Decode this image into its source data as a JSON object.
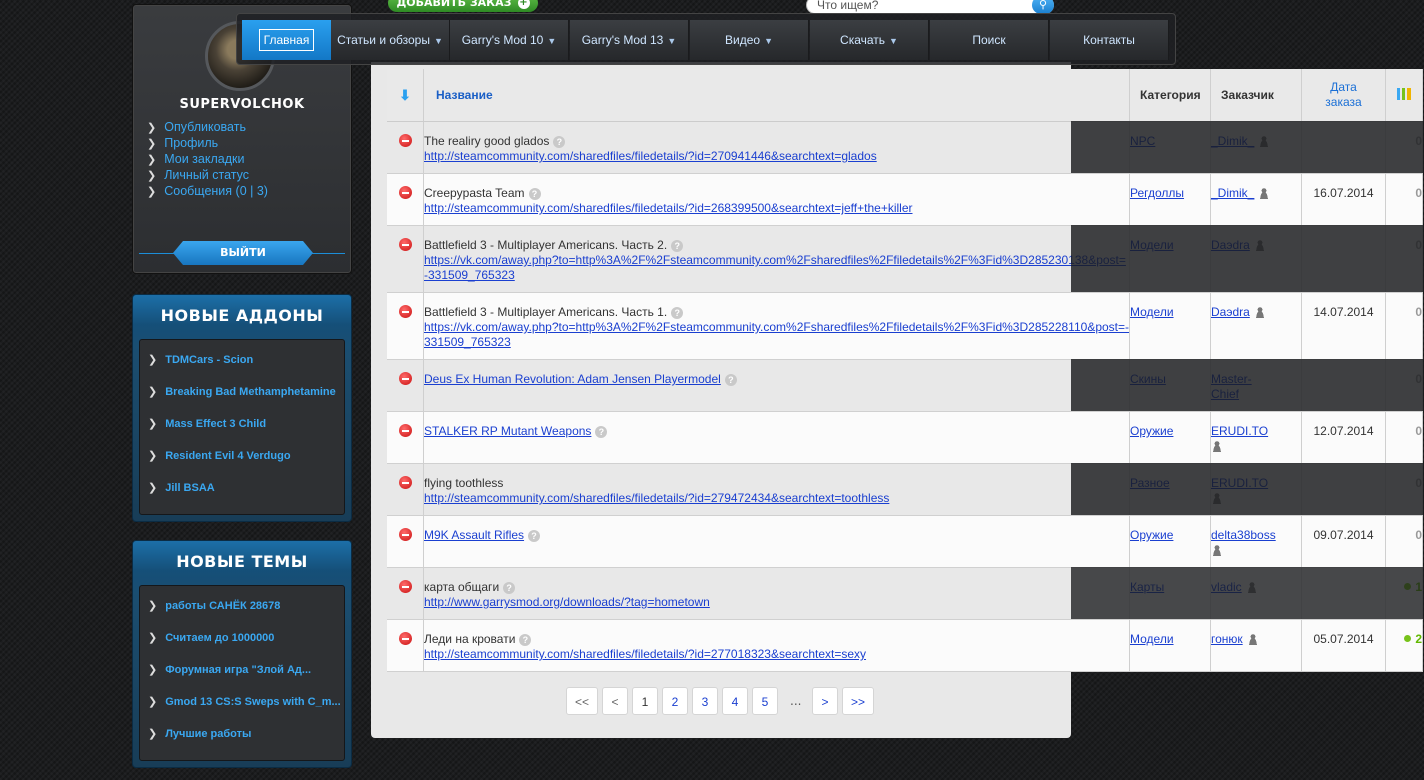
{
  "user": {
    "name": "SUPERVOLCHOK",
    "menu": [
      "Опубликовать",
      "Профиль",
      "Мои закладки",
      "Личный статус",
      "Сообщения (0 | 3)"
    ],
    "logout": "ВЫЙТИ"
  },
  "addons": {
    "title": "НОВЫЕ АДДОНЫ",
    "items": [
      "TDMCars - Scion",
      "Breaking Bad Methamphetamine",
      "Mass Effect 3 Child",
      "Resident Evil 4 Verdugo",
      "Jill BSAA"
    ]
  },
  "topics": {
    "title": "НОВЫЕ ТЕМЫ",
    "items": [
      "работы САНЁК 28678",
      "Считаем до 1000000",
      "Форумная игра \"Злой Ад...",
      "Gmod 13 CS:S Sweps with C_m...",
      "Лучшие работы"
    ]
  },
  "top": {
    "add_order": "ДОБАВИТЬ ЗАКАЗ",
    "search_placeholder": "Что ищем?"
  },
  "nav": [
    "Главная",
    "Статьи и обзоры",
    "Garry's Mod 10",
    "Garry's Mod 13",
    "Видео",
    "Скачать",
    "Поиск",
    "Контакты"
  ],
  "table": {
    "headers": {
      "name": "Название",
      "category": "Категория",
      "customer": "Заказчик",
      "date": "Дата заказа"
    },
    "rows": [
      {
        "title": "The realiry good glados",
        "link": "http://steamcommunity.com/sharedfiles/filedetails/?id=270941446&searchtext=glados",
        "category": "NPC",
        "customer": "_Dimik_",
        "date": "",
        "stat": "0"
      },
      {
        "title": "Creepypasta Team",
        "link": "http://steamcommunity.com/sharedfiles/filedetails/?id=268399500&searchtext=jeff+the+killer",
        "category": "Регдоллы",
        "customer": "_Dimik_",
        "date": "16.07.2014",
        "stat": "0"
      },
      {
        "title": "Battlefield 3 - Multiplayer Americans. Часть 2.",
        "link": "https://vk.com/away.php?to=http%3A%2F%2Fsteamcommunity.com%2Fsharedfiles%2Ffiledetails%2F%3Fid%3D285230138&post=-331509_765323",
        "category": "Модели",
        "customer": "Daэdra",
        "date": "",
        "stat": "0"
      },
      {
        "title": "Battlefield 3 - Multiplayer Americans. Часть 1.",
        "link": "https://vk.com/away.php?to=http%3A%2F%2Fsteamcommunity.com%2Fsharedfiles%2Ffiledetails%2F%3Fid%3D285228110&post=-331509_765323",
        "category": "Модели",
        "customer": "Daэdra",
        "date": "14.07.2014",
        "stat": "0"
      },
      {
        "title": "Deus Ex Human Revolution: Adam Jensen Playermodel",
        "link": "",
        "category": "Скины",
        "customer": "Master-Chief",
        "date": "",
        "stat": "0"
      },
      {
        "title": "STALKER RP Mutant Weapons",
        "link": "",
        "category": "Оружие",
        "customer": "ERUDI.TO",
        "date": "12.07.2014",
        "stat": "0"
      },
      {
        "title": "flying toothless",
        "link": "http://steamcommunity.com/sharedfiles/filedetails/?id=279472434&searchtext=toothless",
        "category": "Разное",
        "customer": "ERUDI.TO",
        "date": "",
        "stat": "0"
      },
      {
        "title": "M9K Assault Rifles",
        "link": "",
        "category": "Оружие",
        "customer": "delta38boss",
        "date": "09.07.2014",
        "stat": "0"
      },
      {
        "title": "карта общаги",
        "link": "http://www.garrysmod.org/downloads/?tag=hometown",
        "category": "Карты",
        "customer": "vladic",
        "date": "",
        "stat": "1"
      },
      {
        "title": "Леди на кровати",
        "link": "http://steamcommunity.com/sharedfiles/filedetails/?id=277018323&searchtext=sexy",
        "category": "Модели",
        "customer": "гонюк",
        "date": "05.07.2014",
        "stat": "2"
      }
    ]
  },
  "pager": [
    "<<",
    "<",
    "1",
    "2",
    "3",
    "4",
    "5",
    "...",
    ">",
    ">>"
  ],
  "colors": {
    "accent": "#1a8fe0",
    "link": "#1a3fd0",
    "delete": "#d21a1a",
    "positive": "#62b800"
  }
}
